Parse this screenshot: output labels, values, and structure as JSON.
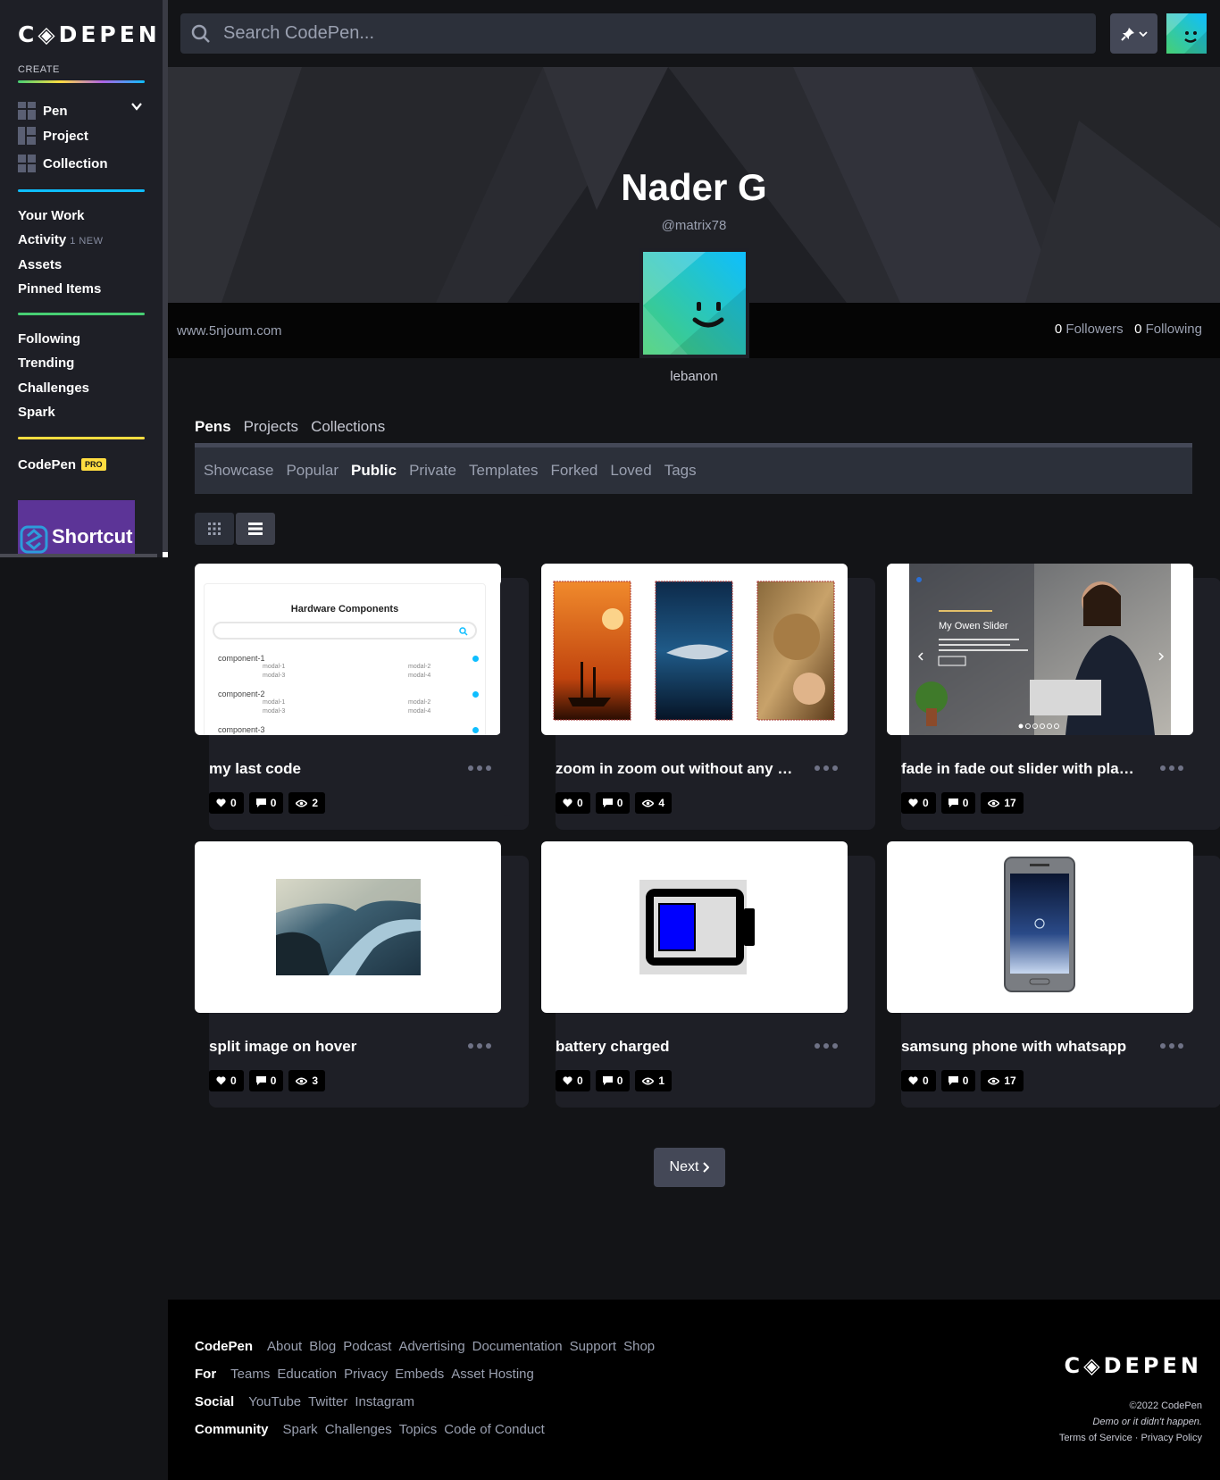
{
  "brand": {
    "logo": "C◈DEPEN"
  },
  "sidebar": {
    "create_label": "CREATE",
    "create_items": [
      {
        "label": "Pen"
      },
      {
        "label": "Project"
      },
      {
        "label": "Collection"
      }
    ],
    "group1": [
      {
        "label": "Your Work"
      },
      {
        "label": "Activity",
        "badge": "1 NEW"
      },
      {
        "label": "Assets"
      },
      {
        "label": "Pinned Items"
      }
    ],
    "group2": [
      {
        "label": "Following"
      },
      {
        "label": "Trending"
      },
      {
        "label": "Challenges"
      },
      {
        "label": "Spark"
      }
    ],
    "codepen_pro": {
      "label": "CodePen",
      "badge": "PRO"
    },
    "ad": {
      "label": "Shortcut"
    }
  },
  "header": {
    "search_placeholder": "Search CodePen..."
  },
  "profile": {
    "name": "Nader G",
    "handle": "@matrix78",
    "website": "www.5njoum.com",
    "followers_count": "0",
    "followers_label": "Followers",
    "following_count": "0",
    "following_label": "Following",
    "location": "lebanon"
  },
  "tabs": {
    "main": [
      "Pens",
      "Projects",
      "Collections"
    ],
    "sub": [
      "Showcase",
      "Popular",
      "Public",
      "Private",
      "Templates",
      "Forked",
      "Loved",
      "Tags"
    ]
  },
  "thumb_texts": {
    "hw_title": "Hardware Components",
    "comp1": "component-1",
    "comp2": "component-2",
    "comp3": "component-3",
    "m1": "modal-1",
    "m2": "modal-2",
    "m3": "modal-3",
    "m4": "modal-4",
    "slider_title": "My Owen Slider"
  },
  "pens": [
    {
      "title": "my last code",
      "likes": "0",
      "comments": "0",
      "views": "2"
    },
    {
      "title": "zoom in zoom out without any p...",
      "likes": "0",
      "comments": "0",
      "views": "4"
    },
    {
      "title": "fade in fade out slider with play ...",
      "likes": "0",
      "comments": "0",
      "views": "17"
    },
    {
      "title": "split image on hover",
      "likes": "0",
      "comments": "0",
      "views": "3"
    },
    {
      "title": "battery charged",
      "likes": "0",
      "comments": "0",
      "views": "1"
    },
    {
      "title": "samsung phone with whatsapp",
      "likes": "0",
      "comments": "0",
      "views": "17"
    }
  ],
  "pagination": {
    "next_label": "Next"
  },
  "footer": {
    "rows": [
      {
        "head": "CodePen",
        "links": [
          "About",
          "Blog",
          "Podcast",
          "Advertising",
          "Documentation",
          "Support",
          "Shop"
        ]
      },
      {
        "head": "For",
        "links": [
          "Teams",
          "Education",
          "Privacy",
          "Embeds",
          "Asset Hosting"
        ]
      },
      {
        "head": "Social",
        "links": [
          "YouTube",
          "Twitter",
          "Instagram"
        ]
      },
      {
        "head": "Community",
        "links": [
          "Spark",
          "Challenges",
          "Topics",
          "Code of Conduct"
        ]
      }
    ],
    "copyright": "©2022 CodePen",
    "tagline": "Demo or it didn't happen.",
    "terms": "Terms of Service",
    "sep": "·",
    "privacy": "Privacy Policy"
  },
  "colors": {
    "bg": "#131417",
    "sidebar": "#1e1f26",
    "accent_green": "#47cf73",
    "accent_blue": "#0ebeff",
    "accent_yellow": "#ffdd40"
  }
}
